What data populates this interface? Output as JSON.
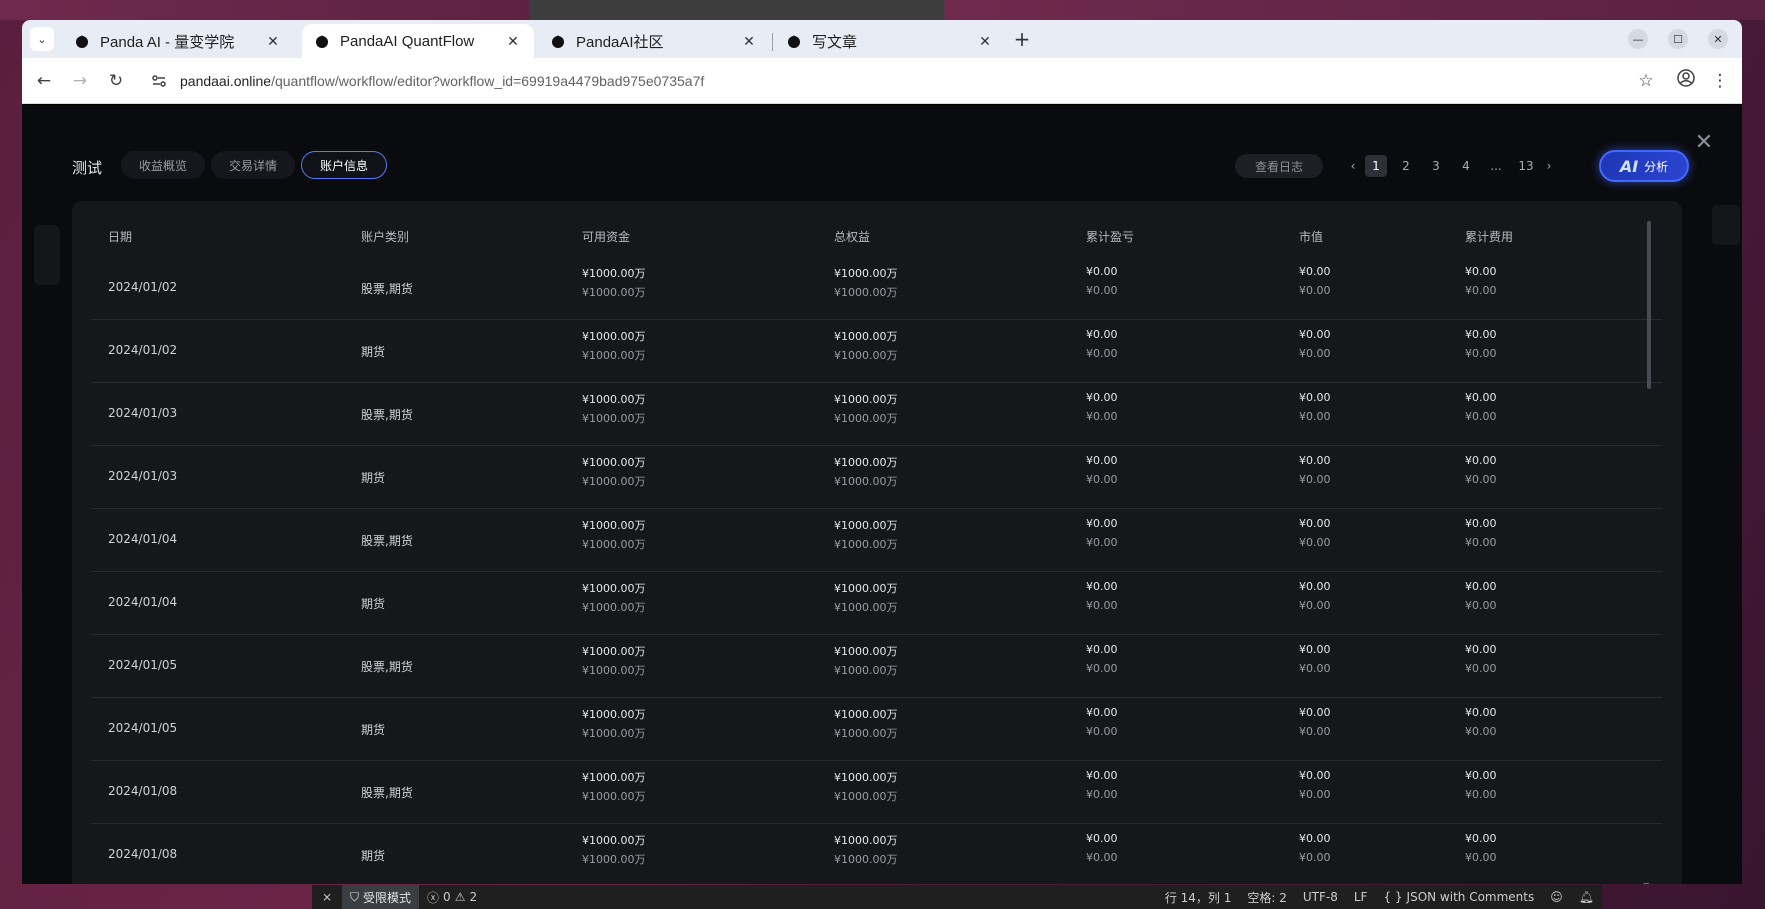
{
  "browser": {
    "tabs": [
      {
        "title": "Panda AI - 量变学院",
        "active": false
      },
      {
        "title": "PandaAI QuantFlow",
        "active": true
      },
      {
        "title": "PandaAI社区",
        "active": false
      },
      {
        "title": "写文章",
        "active": false
      }
    ],
    "close_glyph": "✕",
    "new_tab_glyph": "+",
    "url_host": "pandaai.online",
    "url_path": "/quantflow/workflow/editor?workflow_id=69919a4479bad975e0735a7f"
  },
  "modal": {
    "title": "测试",
    "tabs": [
      "收益概览",
      "交易详情",
      "账户信息"
    ],
    "active_tab": "账户信息",
    "log_button": "查看日志",
    "pager": {
      "pages": [
        "1",
        "2",
        "3",
        "4",
        "...",
        "13"
      ],
      "current": "1",
      "prev": "‹",
      "next": "›"
    },
    "ai_button": {
      "logo": "AI",
      "label": "分析"
    },
    "close_glyph": "✕"
  },
  "table": {
    "headers": [
      "日期",
      "账户类别",
      "可用资金",
      "总权益",
      "累计盈亏",
      "市值",
      "累计费用"
    ],
    "rows": [
      {
        "date": "2024/01/02",
        "type": "股票,期货",
        "avail": [
          "¥1000.00万",
          "¥1000.00万"
        ],
        "equity": [
          "¥1000.00万",
          "¥1000.00万"
        ],
        "pnl": [
          "¥0.00",
          "¥0.00"
        ],
        "mv": [
          "¥0.00",
          "¥0.00"
        ],
        "fee": [
          "¥0.00",
          "¥0.00"
        ]
      },
      {
        "date": "2024/01/02",
        "type": "期货",
        "avail": [
          "¥1000.00万",
          "¥1000.00万"
        ],
        "equity": [
          "¥1000.00万",
          "¥1000.00万"
        ],
        "pnl": [
          "¥0.00",
          "¥0.00"
        ],
        "mv": [
          "¥0.00",
          "¥0.00"
        ],
        "fee": [
          "¥0.00",
          "¥0.00"
        ]
      },
      {
        "date": "2024/01/03",
        "type": "股票,期货",
        "avail": [
          "¥1000.00万",
          "¥1000.00万"
        ],
        "equity": [
          "¥1000.00万",
          "¥1000.00万"
        ],
        "pnl": [
          "¥0.00",
          "¥0.00"
        ],
        "mv": [
          "¥0.00",
          "¥0.00"
        ],
        "fee": [
          "¥0.00",
          "¥0.00"
        ]
      },
      {
        "date": "2024/01/03",
        "type": "期货",
        "avail": [
          "¥1000.00万",
          "¥1000.00万"
        ],
        "equity": [
          "¥1000.00万",
          "¥1000.00万"
        ],
        "pnl": [
          "¥0.00",
          "¥0.00"
        ],
        "mv": [
          "¥0.00",
          "¥0.00"
        ],
        "fee": [
          "¥0.00",
          "¥0.00"
        ]
      },
      {
        "date": "2024/01/04",
        "type": "股票,期货",
        "avail": [
          "¥1000.00万",
          "¥1000.00万"
        ],
        "equity": [
          "¥1000.00万",
          "¥1000.00万"
        ],
        "pnl": [
          "¥0.00",
          "¥0.00"
        ],
        "mv": [
          "¥0.00",
          "¥0.00"
        ],
        "fee": [
          "¥0.00",
          "¥0.00"
        ]
      },
      {
        "date": "2024/01/04",
        "type": "期货",
        "avail": [
          "¥1000.00万",
          "¥1000.00万"
        ],
        "equity": [
          "¥1000.00万",
          "¥1000.00万"
        ],
        "pnl": [
          "¥0.00",
          "¥0.00"
        ],
        "mv": [
          "¥0.00",
          "¥0.00"
        ],
        "fee": [
          "¥0.00",
          "¥0.00"
        ]
      },
      {
        "date": "2024/01/05",
        "type": "股票,期货",
        "avail": [
          "¥1000.00万",
          "¥1000.00万"
        ],
        "equity": [
          "¥1000.00万",
          "¥1000.00万"
        ],
        "pnl": [
          "¥0.00",
          "¥0.00"
        ],
        "mv": [
          "¥0.00",
          "¥0.00"
        ],
        "fee": [
          "¥0.00",
          "¥0.00"
        ]
      },
      {
        "date": "2024/01/05",
        "type": "期货",
        "avail": [
          "¥1000.00万",
          "¥1000.00万"
        ],
        "equity": [
          "¥1000.00万",
          "¥1000.00万"
        ],
        "pnl": [
          "¥0.00",
          "¥0.00"
        ],
        "mv": [
          "¥0.00",
          "¥0.00"
        ],
        "fee": [
          "¥0.00",
          "¥0.00"
        ]
      },
      {
        "date": "2024/01/08",
        "type": "股票,期货",
        "avail": [
          "¥1000.00万",
          "¥1000.00万"
        ],
        "equity": [
          "¥1000.00万",
          "¥1000.00万"
        ],
        "pnl": [
          "¥0.00",
          "¥0.00"
        ],
        "mv": [
          "¥0.00",
          "¥0.00"
        ],
        "fee": [
          "¥0.00",
          "¥0.00"
        ]
      },
      {
        "date": "2024/01/08",
        "type": "期货",
        "avail": [
          "¥1000.00万",
          "¥1000.00万"
        ],
        "equity": [
          "¥1000.00万",
          "¥1000.00万"
        ],
        "pnl": [
          "¥0.00",
          "¥0.00"
        ],
        "mv": [
          "¥0.00",
          "¥0.00"
        ],
        "fee": [
          "¥0.00",
          "¥0.00"
        ]
      }
    ]
  },
  "statusbar": {
    "restricted": "受限模式",
    "errors": "0",
    "warnings": "2",
    "position": "行 14，列 1",
    "spaces": "空格: 2",
    "encoding": "UTF-8",
    "eol": "LF",
    "language": "JSON with Comments"
  }
}
